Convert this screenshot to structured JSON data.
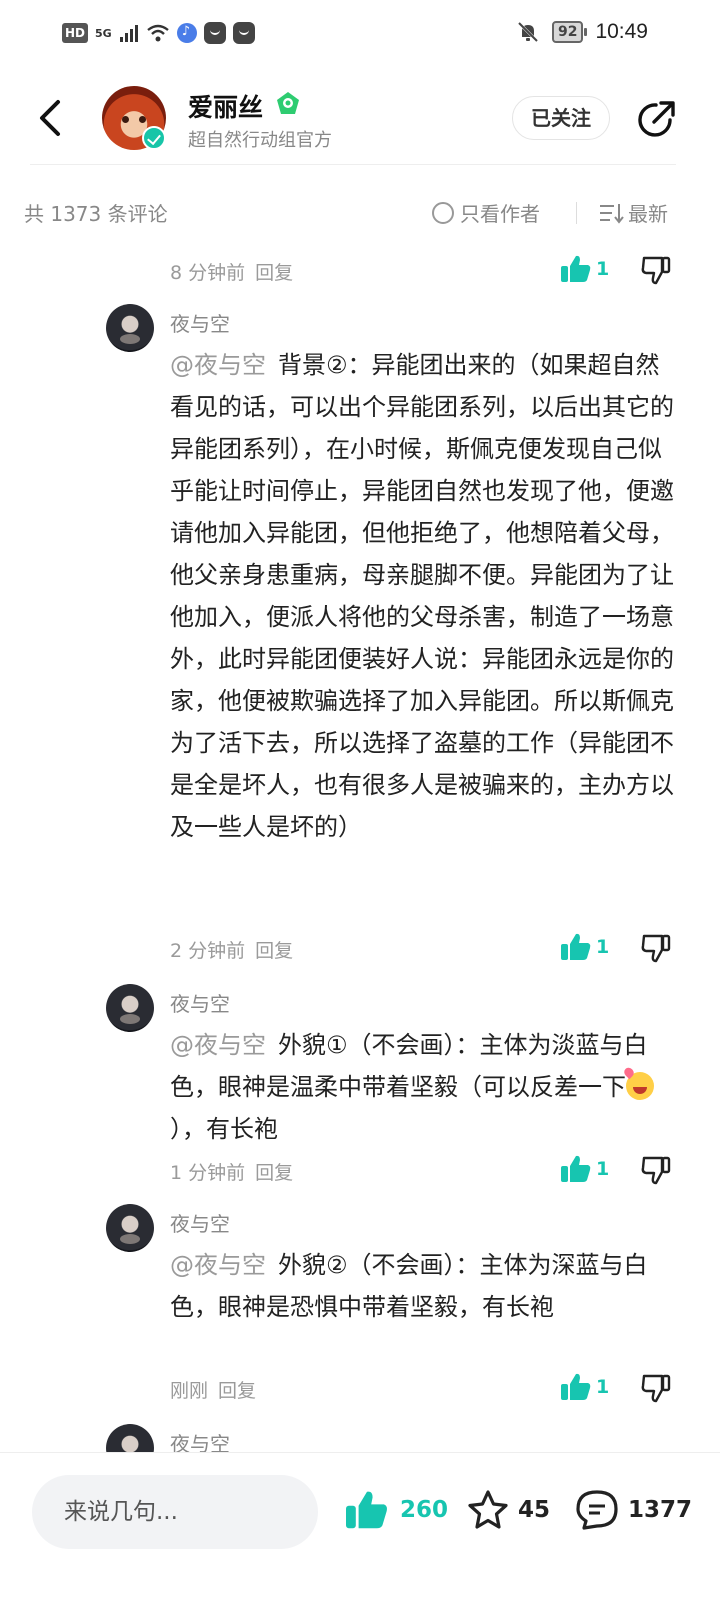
{
  "status_bar": {
    "network_badge": "HD",
    "signal_label": "5G",
    "battery": "92",
    "time": "10:49"
  },
  "header": {
    "author_name": "爱丽丝",
    "author_subtitle": "超自然行动组官方",
    "follow_label": "已关注"
  },
  "toolbar": {
    "comment_count_label": "共 1373 条评论",
    "only_author_label": "只看作者",
    "sort_label": "最新"
  },
  "comments": [
    {
      "time": "8 分钟前",
      "reply_label": "回复",
      "likes": "1"
    },
    {
      "user": "夜与空",
      "mention": "@夜与空",
      "text": "背景②：异能团出来的（如果超自然看见的话，可以出个异能团系列，以后出其它的异能团系列），在小时候，斯佩克便发现自己似乎能让时间停止，异能团自然也发现了他，便邀请他加入异能团，但他拒绝了，他想陪着父母，他父亲身患重病，母亲腿脚不便。异能团为了让他加入，便派人将他的父母杀害，制造了一场意外，此时异能团便装好人说：异能团永远是你的家，他便被欺骗选择了加入异能团。所以斯佩克为了活下去，所以选择了盗墓的工作（异能团不是全是坏人，也有很多人是被骗来的，主办方以及一些人是坏的）",
      "time": "2 分钟前",
      "reply_label": "回复",
      "likes": "1"
    },
    {
      "user": "夜与空",
      "mention": "@夜与空",
      "text_before_emoji": "外貌①（不会画）：主体为淡蓝与白色，眼神是温柔中带着坚毅（可以反差一下",
      "text_after_emoji": "），有长袍",
      "emoji": "laughing-emoji",
      "time": "1 分钟前",
      "reply_label": "回复",
      "likes": "1"
    },
    {
      "user": "夜与空",
      "mention": "@夜与空",
      "text": "外貌②（不会画）：主体为深蓝与白色，眼神是恐惧中带着坚毅，有长袍",
      "time": "刚刚",
      "reply_label": "回复",
      "likes": "1"
    },
    {
      "user": "夜与空"
    }
  ],
  "bottom_bar": {
    "input_placeholder": "来说几句...",
    "like_count": "260",
    "favorite_count": "45",
    "comment_count": "1377"
  },
  "colors": {
    "accent": "#17c5b0",
    "muted_text": "#888888"
  }
}
